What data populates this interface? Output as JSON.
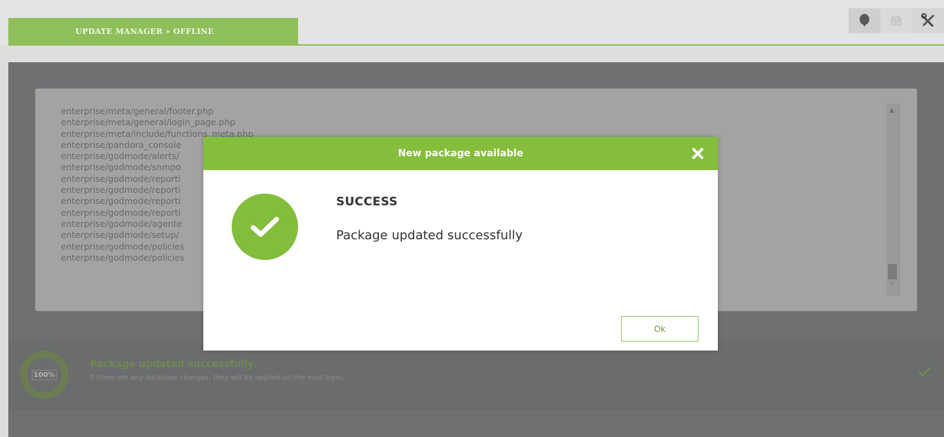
{
  "header": {
    "tab_label": "UPDATE MANAGER » OFFLINE",
    "tools": [
      {
        "icon": "balloon-icon",
        "name": "notifications"
      },
      {
        "icon": "inbox-icon",
        "name": "messages"
      },
      {
        "icon": "tools-icon",
        "name": "settings"
      }
    ]
  },
  "log": {
    "lines": [
      "enterprise/meta/general/footer.php",
      "enterprise/meta/general/login_page.php",
      "enterprise/meta/include/functions_meta.php",
      "enterprise/pandora_console",
      "enterprise/godmode/alerts/",
      "enterprise/godmode/snmpo",
      "enterprise/godmode/reporti",
      "enterprise/godmode/reporti",
      "enterprise/godmode/reporti",
      "enterprise/godmode/reporti",
      "enterprise/godmode/agente",
      "enterprise/godmode/setup/",
      "enterprise/godmode/policies",
      "enterprise/godmode/policies"
    ]
  },
  "status": {
    "progress_label": "100%",
    "progress": 1.0,
    "title": "Package updated successfully.",
    "subtitle": "If there are any database changes, they will be applied on the next login."
  },
  "modal": {
    "title": "New package available",
    "heading": "SUCCESS",
    "message": "Package updated successfully",
    "ok_label": "Ok"
  },
  "colors": {
    "accent": "#84be3c",
    "tab": "#8fbf5a",
    "overlay": "#6f7072"
  }
}
